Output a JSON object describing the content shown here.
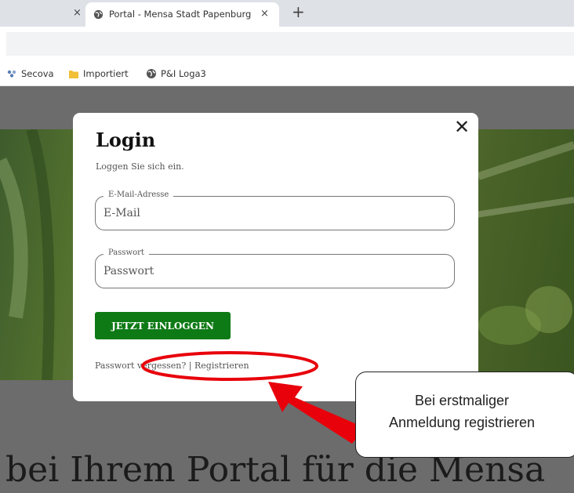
{
  "browser": {
    "active_tab_title": "Portal - Mensa Stadt Papenburg",
    "tab_close_glyph": "×",
    "new_tab_glyph": "+",
    "bookmarks": [
      {
        "label": "Secova",
        "icon": "secova-icon"
      },
      {
        "label": "Importiert",
        "icon": "folder-icon"
      },
      {
        "label": "P&I Loga3",
        "icon": "globe-icon"
      }
    ]
  },
  "modal": {
    "close_glyph": "✕",
    "title": "Login",
    "subtitle": "Loggen Sie sich ein.",
    "email": {
      "legend": "E-Mail-Adresse",
      "placeholder": "E-Mail"
    },
    "password": {
      "legend": "Passwort",
      "placeholder": "Passwort"
    },
    "login_button": "JETZT EINLOGGEN",
    "forgot_link": "Passwort vergessen?",
    "separator": " | ",
    "register_link": "Registrieren"
  },
  "page": {
    "headline": "bei Ihrem Portal für die Mensa"
  },
  "annotation": {
    "callout_line1": "Bei erstmaliger",
    "callout_line2": "Anmeldung registrieren",
    "color": "#e8000b"
  },
  "colors": {
    "button_green": "#0e7a16",
    "overlay_gray": "#6c6c6c",
    "annotation_red": "#e8000b"
  }
}
